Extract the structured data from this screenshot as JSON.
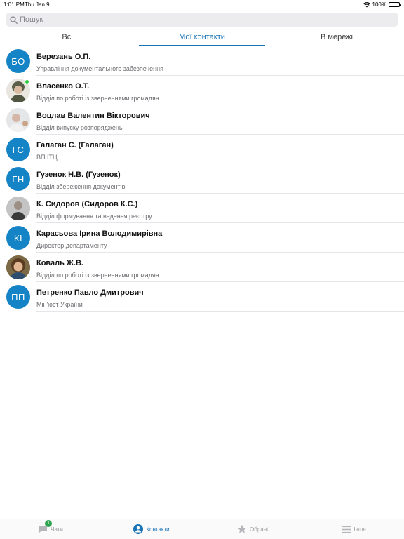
{
  "status_bar": {
    "time": "1:01 PM",
    "date": "Thu Jan 9",
    "battery": "100%"
  },
  "search": {
    "placeholder": "Пошук"
  },
  "tabs": [
    {
      "label": "Всі",
      "active": false
    },
    {
      "label": "Мої контакти",
      "active": true
    },
    {
      "label": "В мережі",
      "active": false
    }
  ],
  "contacts": [
    {
      "initials": "БО",
      "name": "Березань О.П.",
      "subtitle": "Управління документального забезпечення"
    },
    {
      "initials": "",
      "name": "Власенко О.Т.",
      "subtitle": "Відділ по роботі із зверненнями громадян"
    },
    {
      "initials": "",
      "name": "Воцлав Валентин Вікторович",
      "subtitle": "Відділ випуску розпоряджень"
    },
    {
      "initials": "ГС",
      "name": "Галаган С. (Галаган)",
      "subtitle": "ВП ІТЦ"
    },
    {
      "initials": "ГН",
      "name": "Гузенок Н.В. (Гузенок)",
      "subtitle": "Відділ збереження документів"
    },
    {
      "initials": "",
      "name": "К. Сидоров (Сидоров К.С.)",
      "subtitle": "Відділ формування та ведення реєстру"
    },
    {
      "initials": "КІ",
      "name": "Карасьова Ірина Володимирівна",
      "subtitle": "Директор департаменту"
    },
    {
      "initials": "",
      "name": "Коваль Ж.В.",
      "subtitle": "Відділ по роботі із зверненнями громадян"
    },
    {
      "initials": "ПП",
      "name": "Петренко Павло Дмитрович",
      "subtitle": "Мін'юст України"
    }
  ],
  "tabbar": {
    "chats": {
      "label": "Чати",
      "badge": "1",
      "icon": "chat-bubble-icon"
    },
    "contacts": {
      "label": "Контакти",
      "icon": "person-icon"
    },
    "favorites": {
      "label": "Обрані",
      "icon": "star-icon"
    },
    "more": {
      "label": "Інше",
      "icon": "menu-icon"
    }
  },
  "colors": {
    "accent": "#1a73b5",
    "avatar": "#1584c6",
    "online": "#2ecc40"
  }
}
